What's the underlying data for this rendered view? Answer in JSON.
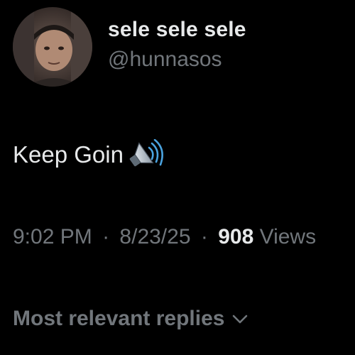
{
  "author": {
    "display_name": "sele sele sele",
    "handle": "@hunnasos",
    "avatar_icon": "profile-photo"
  },
  "post": {
    "text": "Keep Goin",
    "emoji_icon": "speaker-high-volume-icon"
  },
  "meta": {
    "time": "9:02 PM",
    "separator": "·",
    "date": "8/23/25",
    "views_count": "908",
    "views_label": "Views"
  },
  "replies": {
    "sort_label": "Most relevant replies",
    "chevron_icon": "chevron-down-icon"
  },
  "colors": {
    "background": "#000000",
    "primary_text": "#e7e9ea",
    "secondary_text": "#71767b"
  }
}
